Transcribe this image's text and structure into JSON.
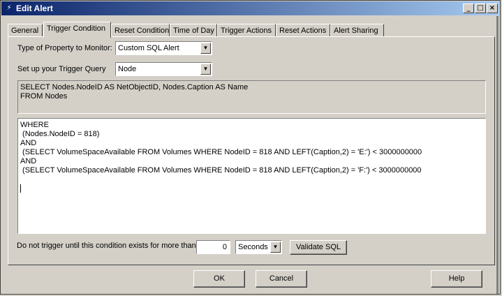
{
  "window": {
    "title": "Edit Alert",
    "controls": {
      "minimize": "_",
      "maximize": "□",
      "close": "×"
    }
  },
  "tabs": [
    {
      "label": "General"
    },
    {
      "label": "Trigger Condition",
      "active": true
    },
    {
      "label": "Reset Condition"
    },
    {
      "label": "Time of Day"
    },
    {
      "label": "Trigger Actions"
    },
    {
      "label": "Reset Actions"
    },
    {
      "label": "Alert Sharing"
    }
  ],
  "form": {
    "property_label": "Type of Property to Monitor:",
    "property_value": "Custom SQL Alert",
    "query_label": "Set up your Trigger Query",
    "query_value": "Node",
    "static_query": "SELECT Nodes.NodeID AS NetObjectID, Nodes.Caption AS Name\nFROM Nodes",
    "where_clause": "WHERE\n (Nodes.NodeID = 818)\nAND\n (SELECT VolumeSpaceAvailable FROM Volumes WHERE NodeID = 818 AND LEFT(Caption,2) = 'E:') < 3000000000\nAND\n (SELECT VolumeSpaceAvailable FROM Volumes WHERE NodeID = 818 AND LEFT(Caption,2) = 'F:') < 3000000000\n\n",
    "duration_label": "Do not trigger until this condition exists for more than",
    "duration_value": "0",
    "duration_unit": "Seconds",
    "validate_label": "Validate SQL"
  },
  "footer": {
    "ok": "OK",
    "cancel": "Cancel",
    "help": "Help"
  }
}
